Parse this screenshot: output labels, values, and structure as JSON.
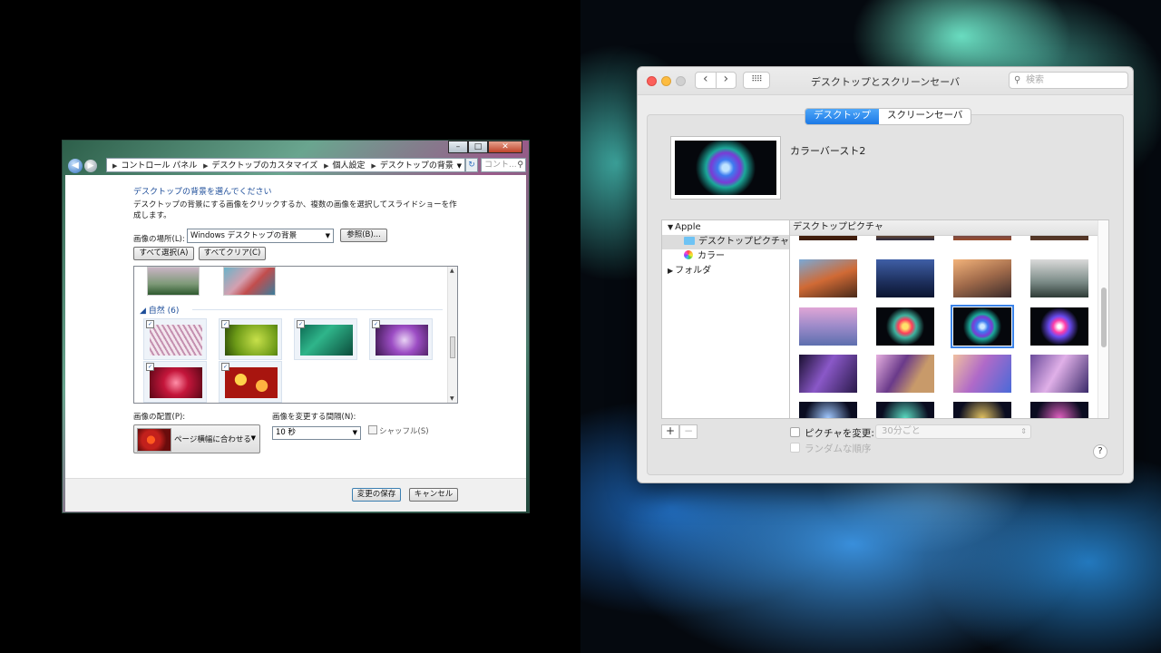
{
  "windows": {
    "address": {
      "crumbs": [
        "コントロール パネル",
        "デスクトップのカスタマイズ",
        "個人設定",
        "デスクトップの背景"
      ],
      "search_placeholder": "コント..."
    },
    "heading": "デスクトップの背景を選んでください",
    "description": "デスクトップの背景にする画像をクリックするか、複数の画像を選択してスライドショーを作成します。",
    "location_label": "画像の場所(L):",
    "location_value": "Windows デスクトップの背景",
    "browse_button": "参照(B)...",
    "select_all_button": "すべて選択(A)",
    "clear_all_button": "すべてクリア(C)",
    "category": "自然 (6)",
    "position_label": "画像の配置(P):",
    "position_value": "ページ横幅に合わせる",
    "interval_label": "画像を変更する間隔(N):",
    "interval_value": "10 秒",
    "shuffle_label": "シャッフル(S)",
    "save_button": "変更の保存",
    "cancel_button": "キャンセル",
    "check_mark": "✓",
    "icons": {
      "back": "back-arrow-icon",
      "forward": "forward-arrow-icon",
      "search": "search-icon",
      "refresh": "refresh-icon"
    }
  },
  "mac": {
    "title": "デスクトップとスクリーンセーバ",
    "search_placeholder": "検索",
    "tabs": [
      {
        "label": "デスクトップ",
        "active": true
      },
      {
        "label": "スクリーンセーバ",
        "active": false
      }
    ],
    "preview_name": "カラーバースト2",
    "sources": {
      "apple": "Apple",
      "desktop_pictures": "デスクトップピクチャ",
      "colors": "カラー",
      "folders": "フォルダ"
    },
    "grid_header": "デスクトップピクチャ",
    "add_button": "+",
    "remove_button": "−",
    "change_picture_label": "ピクチャを変更:",
    "interval_value": "30分ごと",
    "random_order_label": "ランダムな順序",
    "help_button": "?",
    "accent_color": "#1b79e6"
  }
}
